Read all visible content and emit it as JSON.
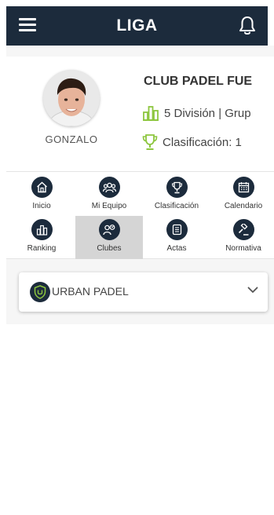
{
  "header": {
    "title": "LIGA"
  },
  "profile": {
    "player_name": "GONZALO",
    "club_name": "CLUB PADEL FUE",
    "division": "5 División | Grup",
    "clasificacion": "Clasificación: 1"
  },
  "nav": {
    "items": [
      {
        "label": "Inicio",
        "icon": "home-icon"
      },
      {
        "label": "Mi Equipo",
        "icon": "team-icon"
      },
      {
        "label": "Clasificación",
        "icon": "trophy-icon"
      },
      {
        "label": "Calendario",
        "icon": "calendar-icon"
      },
      {
        "label": "Ranking",
        "icon": "ranking-icon"
      },
      {
        "label": "Clubes",
        "icon": "clubs-icon",
        "active": true
      },
      {
        "label": "Actas",
        "icon": "document-icon"
      },
      {
        "label": "Normativa",
        "icon": "gavel-icon"
      }
    ]
  },
  "club_select": {
    "value": "URBAN PADEL"
  },
  "colors": {
    "primary": "#1c2b3c",
    "accent": "#8dc63f",
    "active_tab": "#d5d5d5"
  }
}
